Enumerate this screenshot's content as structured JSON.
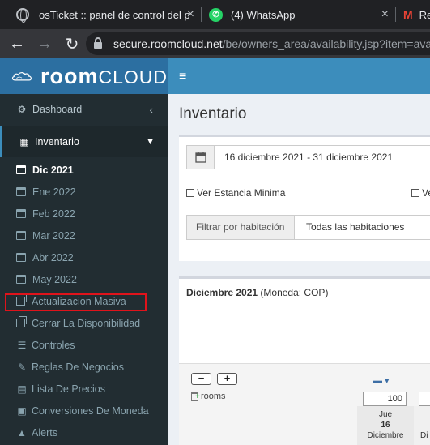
{
  "browser": {
    "tabs": [
      {
        "title": "osTicket :: panel de control del pe",
        "close": "×"
      },
      {
        "title": "(4) WhatsApp",
        "close": "×"
      },
      {
        "title": "Re",
        "close": ""
      }
    ],
    "gmail_glyph": "M",
    "whatsapp_glyph": "✆",
    "url_host": "secure.roomcloud.net",
    "url_path": "/be/owners_area/availability.jsp?item=ava"
  },
  "app": {
    "logo_room": "room",
    "logo_cloud": "CLOUD",
    "menu_icon": "≡"
  },
  "sidebar": {
    "dashboard": "Dashboard",
    "inventario": "Inventario",
    "months": [
      "Dic 2021",
      "Ene 2022",
      "Feb 2022",
      "Mar 2022",
      "Abr 2022",
      "May 2022"
    ],
    "actualizacion": "Actualizacion Masiva",
    "cerrar": "Cerrar La Disponibilidad",
    "controles": "Controles",
    "reglas": "Reglas De Negocios",
    "precios": "Lista De Precios",
    "conversiones": "Conversiones De Moneda",
    "alerts": "Alerts"
  },
  "main": {
    "title": "Inventario",
    "date_range": "16 diciembre 2021 - 31 diciembre 2021",
    "ver_estancia": "Ver Estancia Minima",
    "ver_other": "Ve",
    "filtrar_label": "Filtrar por habitación",
    "filtrar_value": "Todas las habitaciones",
    "month_title": "Diciembre 2021",
    "moneda": "(Moneda: COP)",
    "minus": "−",
    "plus": "+",
    "rooms_label": "rooms",
    "value_1": "100",
    "day_name": "Jue",
    "day_num": "16",
    "day_month": "Diciembre",
    "day2_partial": "Di"
  },
  "colors": {
    "brand_blue": "#3c8dbc",
    "sidebar_bg": "#222d32",
    "highlight_red": "#e0131b"
  }
}
